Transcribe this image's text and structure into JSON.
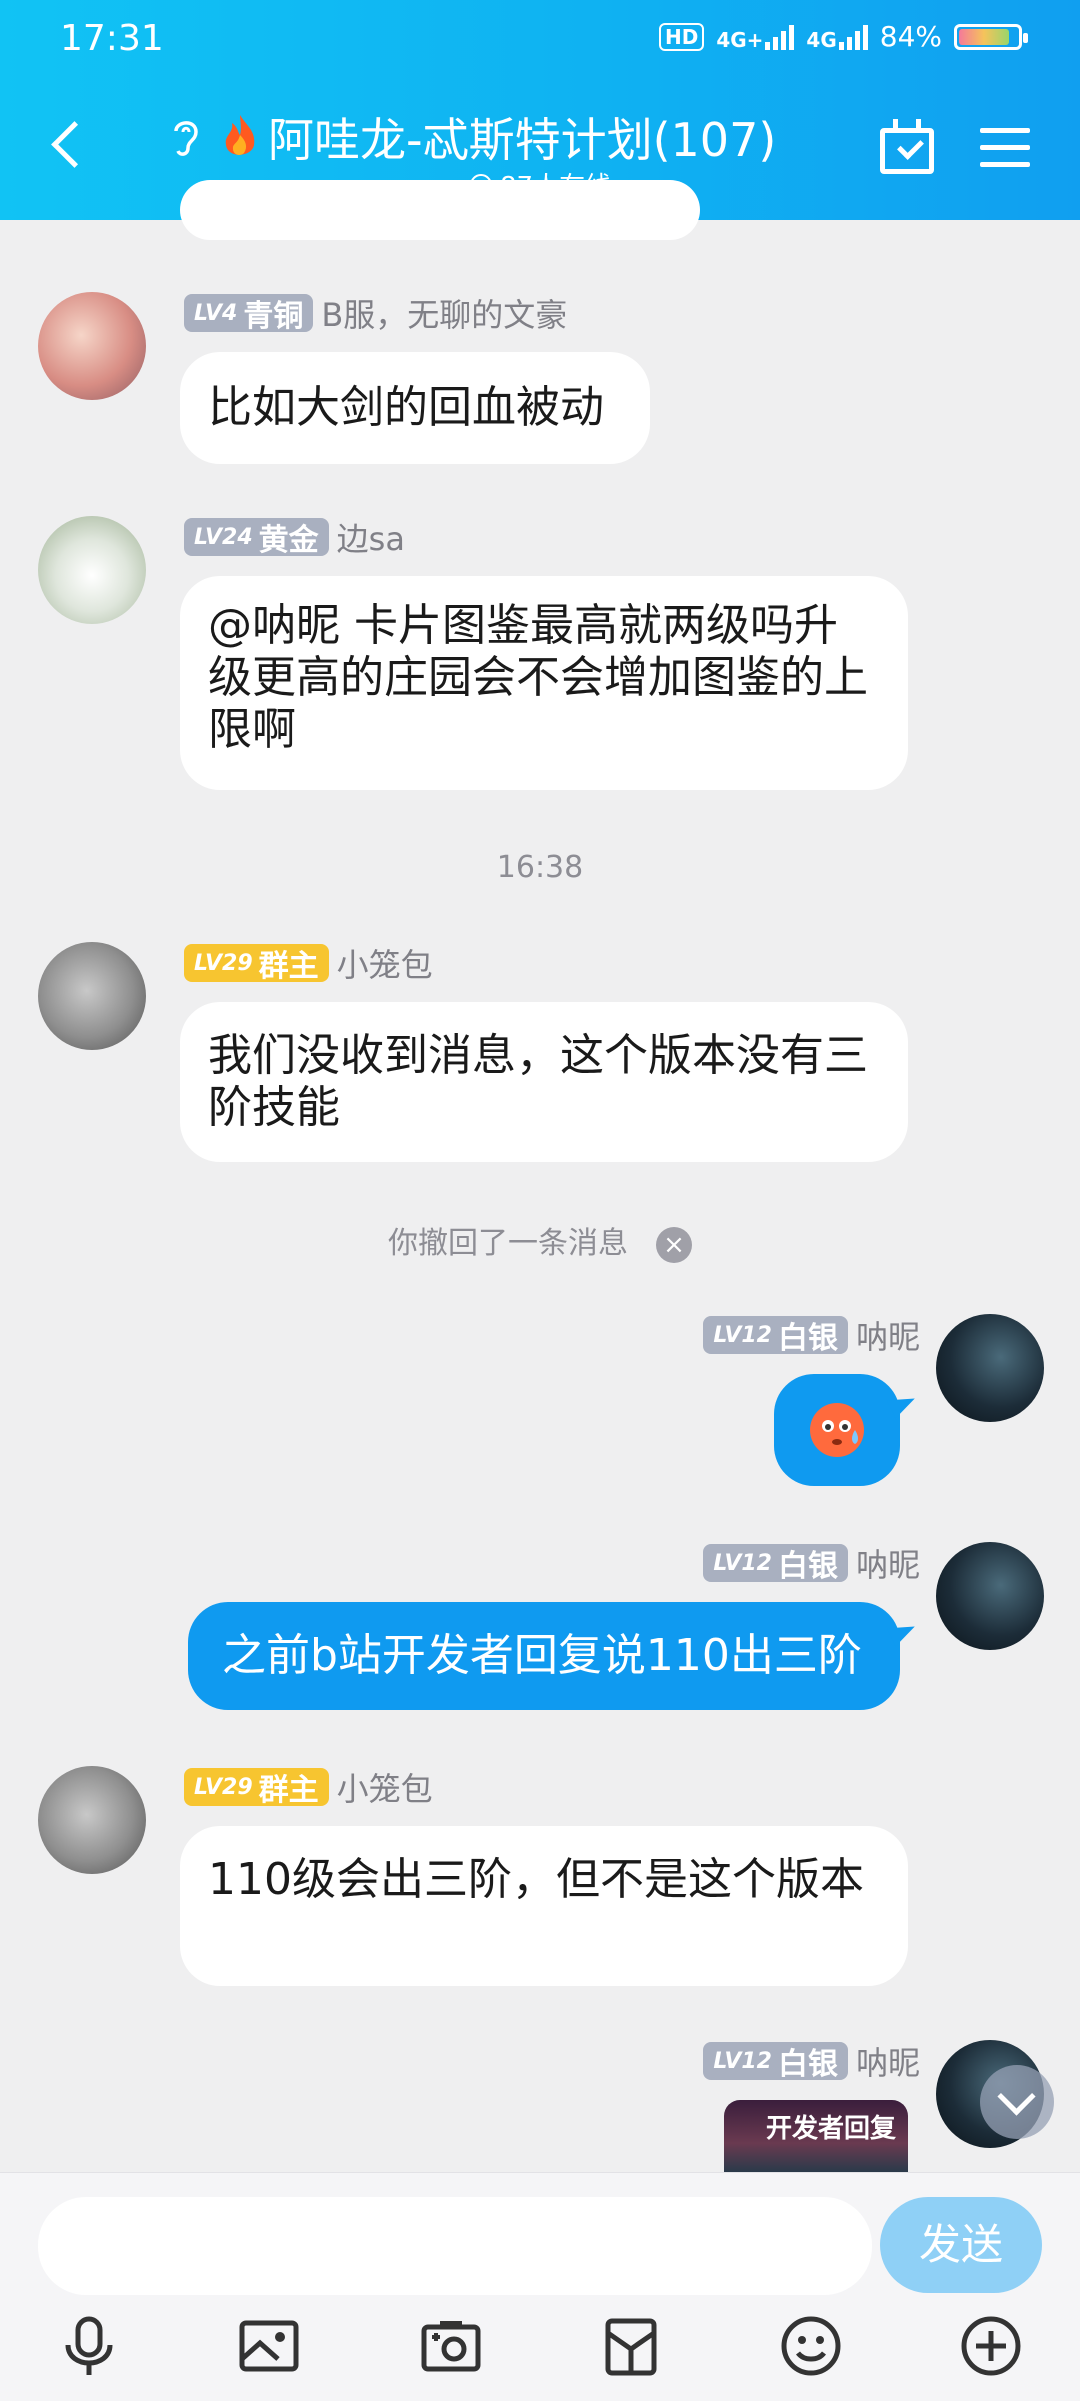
{
  "status_bar": {
    "time": "17:31",
    "network1": "4G+",
    "network2": "4G",
    "battery": "84%",
    "hd": "HD"
  },
  "header": {
    "title": "阿哇龙-忒斯特计划(107)",
    "subtitle": "87人在线"
  },
  "messages": [
    {
      "level": "LV4",
      "rank": "青铜",
      "name": "B服，无聊的文豪",
      "text": "比如大剑的回血被动"
    },
    {
      "level": "LV24",
      "rank": "黄金",
      "name": "边sa",
      "text": "@呐昵 卡片图鉴最高就两级吗升级更高的庄园会不会增加图鉴的上限啊"
    },
    {
      "level": "LV29",
      "rank": "群主",
      "name": "小笼包",
      "text": "我们没收到消息，这个版本没有三阶技能"
    },
    {
      "level": "LV12",
      "rank": "白银",
      "name": "呐昵"
    },
    {
      "level": "LV12",
      "rank": "白银",
      "name": "呐昵",
      "text": "之前b站开发者回复说110出三阶"
    },
    {
      "level": "LV29",
      "rank": "群主",
      "name": "小笼包",
      "text": "110级会出三阶，但不是这个版本"
    },
    {
      "level": "LV12",
      "rank": "白银",
      "name": "呐昵",
      "image_text": "开发者回复"
    }
  ],
  "timestamp": "16:38",
  "recall_note": "你撤回了一条消息",
  "input": {
    "send_label": "发送",
    "placeholder": ""
  },
  "colors": {
    "header": "#0fb2f2",
    "accent_blue": "#0f9af0",
    "gold_badge": "#f7c530",
    "gray_badge": "#a9b0c0",
    "send_disabled": "#8fd0f6"
  },
  "icons": [
    "microphone-icon",
    "image-icon",
    "camera-icon",
    "folder-icon",
    "emoji-icon",
    "plus-icon"
  ]
}
